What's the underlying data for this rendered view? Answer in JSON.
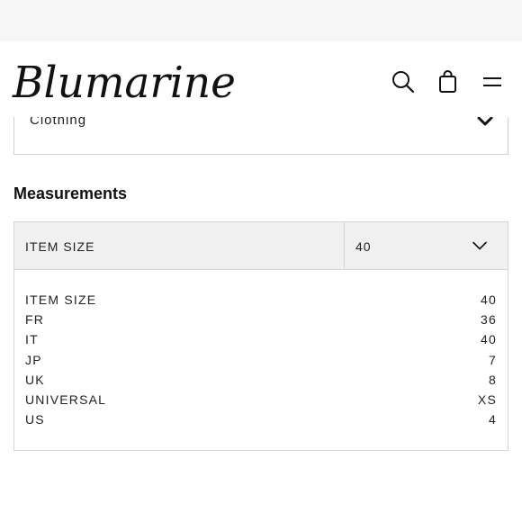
{
  "brand": {
    "name": "Blumarine"
  },
  "category": {
    "label": "Clothing"
  },
  "measurements": {
    "title": "Measurements",
    "header_label": "ITEM SIZE",
    "selected_size": "40",
    "rows": [
      {
        "label": "ITEM SIZE",
        "value": "40"
      },
      {
        "label": "FR",
        "value": "36"
      },
      {
        "label": "IT",
        "value": "40"
      },
      {
        "label": "JP",
        "value": "7"
      },
      {
        "label": "UK",
        "value": "8"
      },
      {
        "label": "UNIVERSAL",
        "value": "XS"
      },
      {
        "label": "US",
        "value": "4"
      }
    ]
  },
  "icons": {
    "search": "search-icon",
    "bag": "shopping-bag-icon",
    "menu": "menu-icon",
    "chevron": "chevron-down-icon"
  }
}
